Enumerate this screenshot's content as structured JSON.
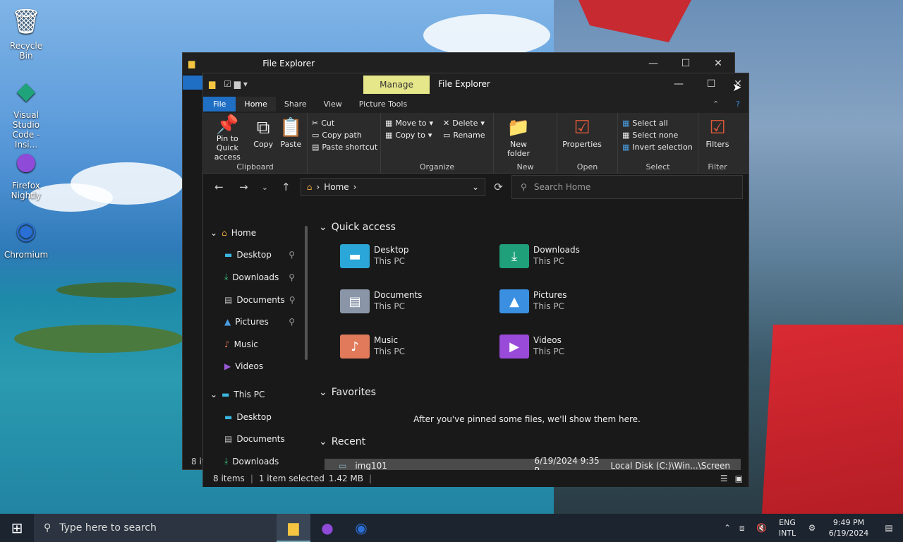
{
  "desktop": {
    "icons": [
      {
        "label": "Recycle Bin",
        "icon": "recycle-bin-icon"
      },
      {
        "label": "Visual Studio Code - Insi...",
        "icon": "vscode-icon"
      },
      {
        "label": "Firefox Nightly",
        "icon": "firefox-icon"
      },
      {
        "label": "Chromium",
        "icon": "chromium-icon"
      }
    ]
  },
  "back_window": {
    "title": "File Explorer",
    "status_items": "8 items"
  },
  "front_window": {
    "title": "File Explorer",
    "context_tab": "Manage",
    "tabs": [
      "File",
      "Home",
      "Share",
      "View",
      "Picture Tools"
    ],
    "ribbon": {
      "clipboard": {
        "label": "Clipboard",
        "pin": "Pin to Quick access",
        "copy": "Copy",
        "paste": "Paste",
        "cut": "Cut",
        "copy_path": "Copy path",
        "paste_shortcut": "Paste shortcut"
      },
      "organize": {
        "label": "Organize",
        "move_to": "Move to",
        "copy_to": "Copy to",
        "delete": "Delete",
        "rename": "Rename"
      },
      "new": {
        "label": "New",
        "new_folder": "New folder"
      },
      "open": {
        "label": "Open",
        "properties": "Properties"
      },
      "select": {
        "label": "Select",
        "select_all": "Select all",
        "select_none": "Select none",
        "invert": "Invert selection"
      },
      "filter": {
        "label": "Filter",
        "filters": "Filters"
      }
    },
    "address": {
      "path": "Home",
      "search_placeholder": "Search Home"
    },
    "nav": {
      "home": "Home",
      "quick": [
        "Desktop",
        "Downloads",
        "Documents",
        "Pictures",
        "Music",
        "Videos"
      ],
      "this_pc": "This PC",
      "pc_items": [
        "Desktop",
        "Documents",
        "Downloads"
      ]
    },
    "content": {
      "quick_access": "Quick access",
      "items": [
        {
          "name": "Desktop",
          "sub": "This PC"
        },
        {
          "name": "Downloads",
          "sub": "This PC"
        },
        {
          "name": "Documents",
          "sub": "This PC"
        },
        {
          "name": "Pictures",
          "sub": "This PC"
        },
        {
          "name": "Music",
          "sub": "This PC"
        },
        {
          "name": "Videos",
          "sub": "This PC"
        }
      ],
      "favorites": "Favorites",
      "favorites_empty": "After you've pinned some files, we'll show them here.",
      "recent": "Recent",
      "recent_items": [
        {
          "name": "img101",
          "date": "6/19/2024 9:35 P...",
          "location": "Local Disk (C:)\\Win...\\Screen"
        }
      ]
    },
    "status": {
      "items": "8 items",
      "selected": "1 item selected",
      "size": "1.42 MB"
    }
  },
  "taskbar": {
    "search_placeholder": "Type here to search",
    "lang1": "ENG",
    "lang2": "INTL",
    "time": "9:49 PM",
    "date": "6/19/2024"
  }
}
